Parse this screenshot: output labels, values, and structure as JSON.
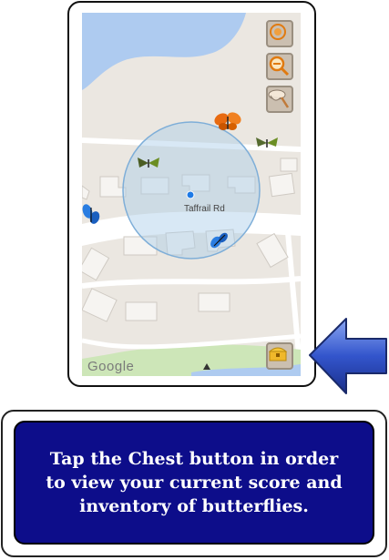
{
  "map": {
    "road_name": "Taffrail Rd",
    "attribution": "Google"
  },
  "controls": [
    {
      "name": "locate-icon"
    },
    {
      "name": "zoom-out-magnifier-icon"
    },
    {
      "name": "butterfly-net-icon"
    },
    {
      "name": "chest-icon"
    }
  ],
  "colors": {
    "water": "#aecbf0",
    "park": "#cde6b8",
    "range_circle": "#a9cbe8",
    "banner": "#0d0d8a",
    "arrow": "#3355cc"
  },
  "instruction": {
    "text": "Tap the Chest button in order to view your current score and inventory of butterflies."
  }
}
